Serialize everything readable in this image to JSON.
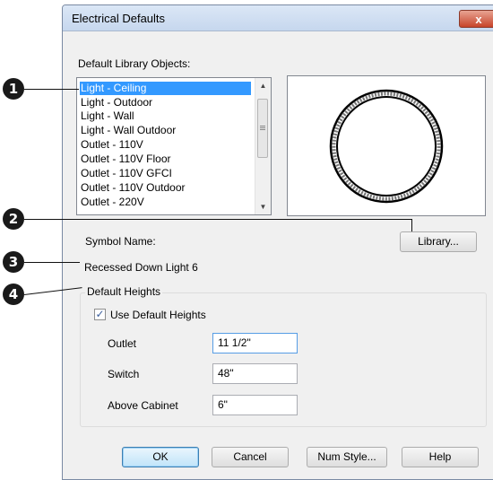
{
  "dialog": {
    "title": "Electrical Defaults",
    "close_glyph": "x"
  },
  "library_objects": {
    "label": "Default Library Objects:",
    "items": [
      "Light - Ceiling",
      "Light - Outdoor",
      "Light - Wall",
      "Light - Wall Outdoor",
      "Outlet - 110V",
      "Outlet - 110V Floor",
      "Outlet - 110V GFCI",
      "Outlet - 110V Outdoor",
      "Outlet - 220V"
    ],
    "selected": "Light - Ceiling"
  },
  "symbol": {
    "label": "Symbol Name:",
    "value": "Recessed Down Light 6",
    "library_button": "Library..."
  },
  "default_heights": {
    "group_label": "Default Heights",
    "use_default_label": "Use Default Heights",
    "use_default_checked": true,
    "check_glyph": "✓",
    "fields": [
      {
        "label": "Outlet",
        "value": "11 1/2\""
      },
      {
        "label": "Switch",
        "value": "48\""
      },
      {
        "label": "Above Cabinet",
        "value": "6\""
      }
    ]
  },
  "buttons": {
    "ok": "OK",
    "cancel": "Cancel",
    "num_style": "Num Style...",
    "help": "Help"
  },
  "callouts": [
    "1",
    "2",
    "3",
    "4"
  ],
  "icons": {
    "preview": "recessed-light-symbol",
    "scroll_up": "chevron-up-icon",
    "scroll_down": "chevron-down-icon",
    "close": "close-icon"
  }
}
